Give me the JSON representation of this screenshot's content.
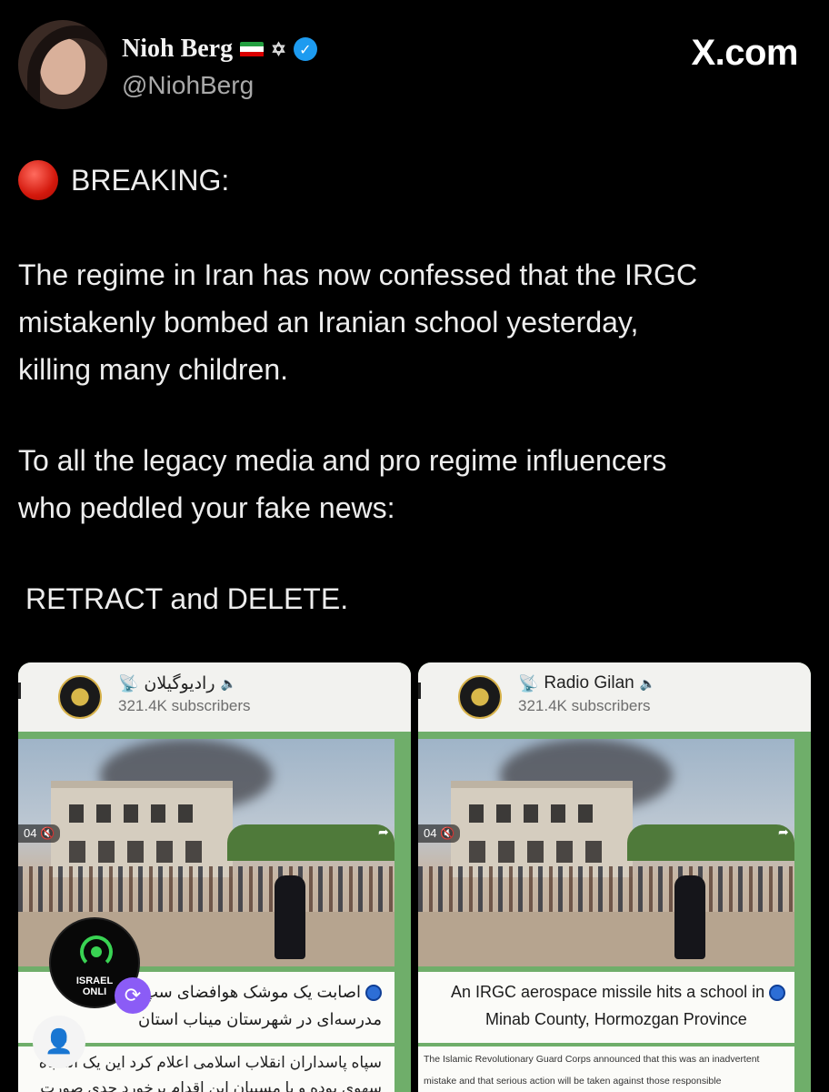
{
  "author": {
    "name": "Nioh Berg",
    "handle": "@NiohBerg",
    "badges": [
      "iran-flag-icon",
      "star-of-david-icon",
      "verified-icon"
    ]
  },
  "brand": "X.com",
  "post": {
    "breaking": "BREAKING:",
    "para1_lines": [
      "The regime in Iran has now confessed that the IRGC",
      "mistakenly bombed an Iranian school yesterday,",
      "killing many children."
    ],
    "para2_lines": [
      "To all the legacy media and pro regime influencers",
      "who peddled your fake news:"
    ],
    "para3": "RETRACT and DELETE."
  },
  "media_left": {
    "channel": "راديوگيلان",
    "subscribers": "321.4K subscribers",
    "video_time": "04",
    "caption_lines": [
      "اصابت یک موشک هوافضای سپ",
      "مدرسه‌ای در شهرستان میناب استان"
    ],
    "body_lines": [
      "سپاه پاسداران انقلاب اسلامی اعلام کرد این یک اشتباه",
      "سهوی بوده و با مسببان این اقدام برخورد جدی صورت"
    ]
  },
  "media_right": {
    "channel": "Radio Gilan",
    "subscribers": "321.4K subscribers",
    "video_time": "04",
    "caption_lines": [
      "An IRGC aerospace missile hits a school in",
      "Minab County, Hormozgan Province"
    ],
    "body_lines": [
      "The Islamic Revolutionary Guard Corps announced that this was an inadvertent",
      "mistake and that serious action will be taken against those responsible"
    ]
  },
  "watermark": {
    "line1": "ISRAEL",
    "line2": "ONLI"
  },
  "colors": {
    "background": "#000000",
    "verified": "#1d9bf0",
    "breaking_dot": "#d3180c",
    "telegram_green": "#6fae6a"
  }
}
